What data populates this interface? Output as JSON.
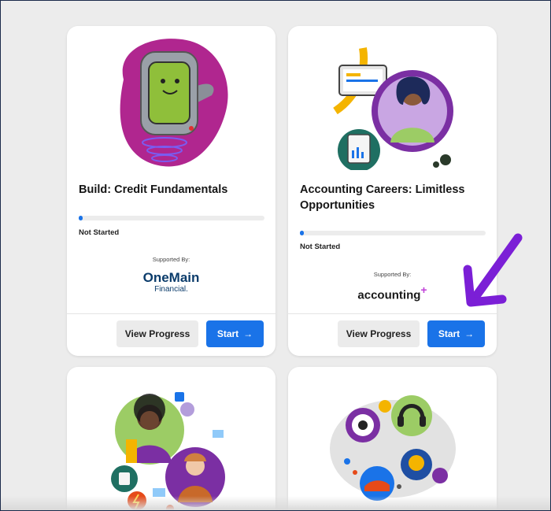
{
  "cards": [
    {
      "title": "Build: Credit Fundamentals",
      "progress_fraction": 0.02,
      "status": "Not Started",
      "supported_by": "Supported By:",
      "sponsor_line1": "OneMain",
      "sponsor_line2": "Financial.",
      "view_progress_label": "View Progress",
      "start_label": "Start",
      "start_icon": "→"
    },
    {
      "title": "Accounting Careers: Limitless Opportunities",
      "progress_fraction": 0.02,
      "status": "Not Started",
      "supported_by": "Supported By:",
      "sponsor_name": "accounting",
      "sponsor_plus": "+",
      "view_progress_label": "View Progress",
      "start_label": "Start",
      "start_icon": "→"
    }
  ],
  "colors": {
    "accent_blue": "#1a73e8",
    "annotation_arrow": "#7b1fd6",
    "sponsor_onemain": "#0b3c6b"
  }
}
